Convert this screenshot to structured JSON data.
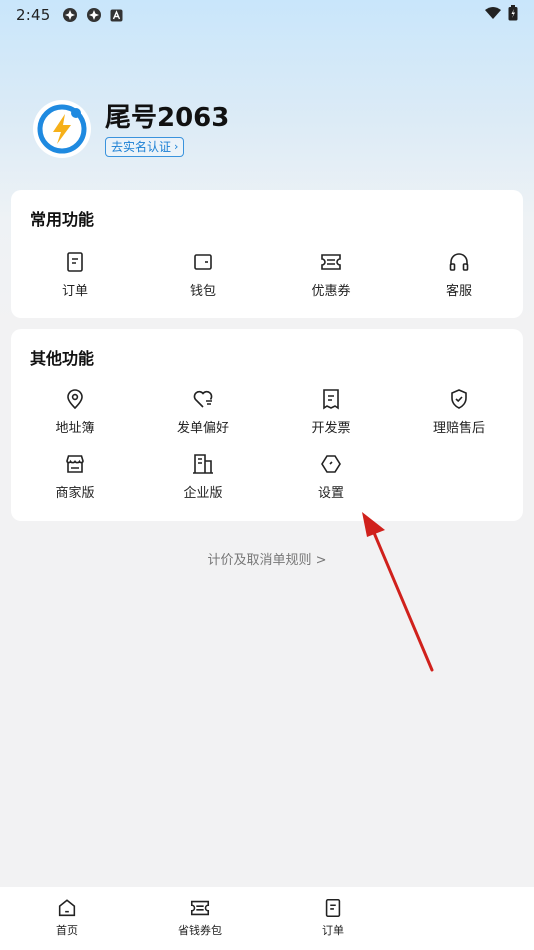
{
  "status_bar": {
    "time": "2:45",
    "icons_left": [
      "app-icon",
      "app-icon",
      "notification-icon"
    ],
    "icons_right": [
      "wifi-icon",
      "battery-icon"
    ]
  },
  "profile": {
    "username": "尾号2063",
    "verify_label": "去实名认证",
    "avatar_icon": "lightning-icon",
    "accent_color": "#1a7fd4"
  },
  "common_functions": {
    "title": "常用功能",
    "items": [
      {
        "label": "订单",
        "icon": "order-icon"
      },
      {
        "label": "钱包",
        "icon": "wallet-icon"
      },
      {
        "label": "优惠券",
        "icon": "coupon-icon"
      },
      {
        "label": "客服",
        "icon": "headset-icon"
      }
    ]
  },
  "other_functions": {
    "title": "其他功能",
    "items": [
      {
        "label": "地址簿",
        "icon": "location-icon"
      },
      {
        "label": "发单偏好",
        "icon": "heart-icon"
      },
      {
        "label": "开发票",
        "icon": "invoice-icon"
      },
      {
        "label": "理赔售后",
        "icon": "shield-icon"
      },
      {
        "label": "商家版",
        "icon": "store-icon"
      },
      {
        "label": "企业版",
        "icon": "building-icon"
      },
      {
        "label": "设置",
        "icon": "settings-icon"
      }
    ]
  },
  "rules_link": "计价及取消单规则 >",
  "bottom_nav": {
    "items": [
      {
        "label": "首页",
        "icon": "home-icon"
      },
      {
        "label": "省钱券包",
        "icon": "coupon-icon"
      },
      {
        "label": "订单",
        "icon": "order-icon"
      }
    ]
  },
  "annotation_color": "#d0211c"
}
